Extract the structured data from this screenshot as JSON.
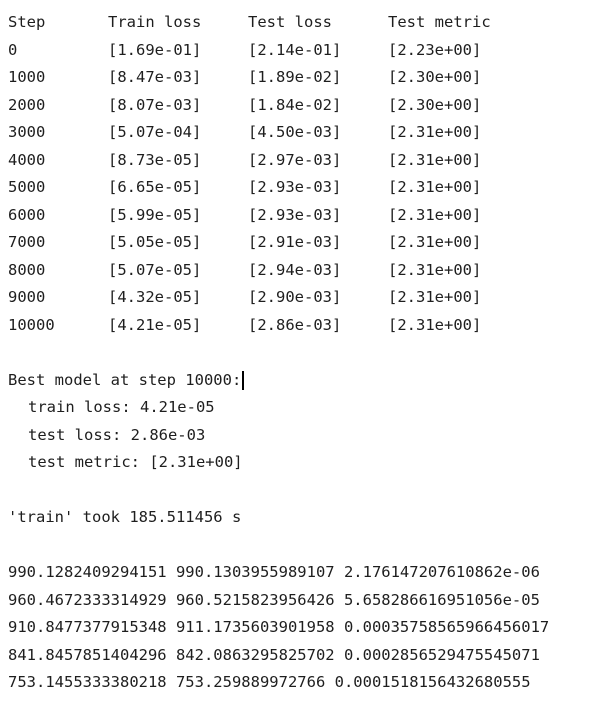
{
  "table": {
    "headers": [
      "Step",
      "Train loss",
      "Test loss",
      "Test metric"
    ],
    "rows": [
      [
        "0",
        "[1.69e-01]",
        "[2.14e-01]",
        "[2.23e+00]"
      ],
      [
        "1000",
        "[8.47e-03]",
        "[1.89e-02]",
        "[2.30e+00]"
      ],
      [
        "2000",
        "[8.07e-03]",
        "[1.84e-02]",
        "[2.30e+00]"
      ],
      [
        "3000",
        "[5.07e-04]",
        "[4.50e-03]",
        "[2.31e+00]"
      ],
      [
        "4000",
        "[8.73e-05]",
        "[2.97e-03]",
        "[2.31e+00]"
      ],
      [
        "5000",
        "[6.65e-05]",
        "[2.93e-03]",
        "[2.31e+00]"
      ],
      [
        "6000",
        "[5.99e-05]",
        "[2.93e-03]",
        "[2.31e+00]"
      ],
      [
        "7000",
        "[5.05e-05]",
        "[2.91e-03]",
        "[2.31e+00]"
      ],
      [
        "8000",
        "[5.07e-05]",
        "[2.94e-03]",
        "[2.31e+00]"
      ],
      [
        "9000",
        "[4.32e-05]",
        "[2.90e-03]",
        "[2.31e+00]"
      ],
      [
        "10000",
        "[4.21e-05]",
        "[2.86e-03]",
        "[2.31e+00]"
      ]
    ]
  },
  "best": {
    "header": "Best model at step 10000:",
    "train": "train loss: 4.21e-05",
    "test": "test loss: 2.86e-03",
    "metric": "test metric: [2.31e+00]"
  },
  "timing": "'train' took 185.511456 s",
  "values": [
    "990.1282409294151 990.1303955989107 2.176147207610862e-06",
    "960.4672333314929 960.5215823956426 5.658286616951056e-05",
    "910.8477377915348 911.1735603901958 0.00035758565966456017",
    "841.8457851404296 842.0863295825702 0.0002856529475545071",
    "753.1455333380218 753.259889972766 0.0001518156432680555"
  ]
}
